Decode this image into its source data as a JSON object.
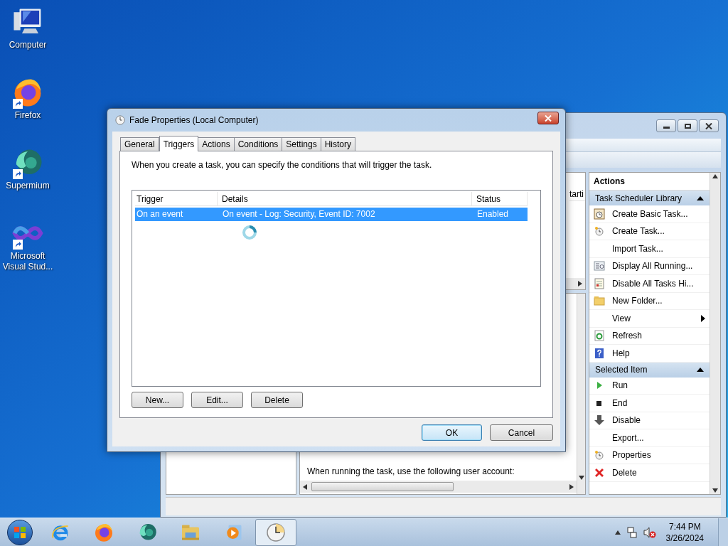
{
  "desktop_icons": [
    {
      "label": "Computer",
      "kind": "computer"
    },
    {
      "label": "Firefox",
      "kind": "firefox"
    },
    {
      "label": "Supermium",
      "kind": "supermium"
    },
    {
      "label": "Microsoft Visual Stud...",
      "kind": "vs"
    }
  ],
  "background_window": {
    "column_header": "tarti",
    "body_text": "When running the task, use the following user account:",
    "actions": {
      "title": "Actions",
      "groups": [
        {
          "title": "Task Scheduler Library",
          "expanded": true,
          "items": [
            {
              "label": "Create Basic Task...",
              "kind": "wizard",
              "submenu": false
            },
            {
              "label": "Create Task...",
              "kind": "clock",
              "submenu": false
            },
            {
              "label": "Import Task...",
              "kind": "none",
              "submenu": false
            },
            {
              "label": "Display All Running...",
              "kind": "list",
              "submenu": false
            },
            {
              "label": "Disable All Tasks Hi...",
              "kind": "notes",
              "submenu": false
            },
            {
              "label": "New Folder...",
              "kind": "folder",
              "submenu": false
            },
            {
              "label": "View",
              "kind": "none",
              "submenu": true
            },
            {
              "label": "Refresh",
              "kind": "refresh",
              "submenu": false
            },
            {
              "label": "Help",
              "kind": "help",
              "submenu": false
            }
          ]
        },
        {
          "title": "Selected Item",
          "expanded": true,
          "items": [
            {
              "label": "Run",
              "kind": "run",
              "submenu": false
            },
            {
              "label": "End",
              "kind": "end",
              "submenu": false
            },
            {
              "label": "Disable",
              "kind": "down",
              "submenu": false
            },
            {
              "label": "Export...",
              "kind": "none",
              "submenu": false
            },
            {
              "label": "Properties",
              "kind": "clock",
              "submenu": false
            },
            {
              "label": "Delete",
              "kind": "delete",
              "submenu": false
            }
          ]
        }
      ]
    }
  },
  "dialog": {
    "title": "Fade Properties (Local Computer)",
    "tabs": [
      {
        "label": "General",
        "selected": false
      },
      {
        "label": "Triggers",
        "selected": true
      },
      {
        "label": "Actions",
        "selected": false
      },
      {
        "label": "Conditions",
        "selected": false
      },
      {
        "label": "Settings",
        "selected": false
      },
      {
        "label": "History",
        "selected": false
      }
    ],
    "description": "When you create a task, you can specify the conditions that will trigger the task.",
    "table": {
      "columns": [
        "Trigger",
        "Details",
        "Status"
      ],
      "rows": [
        {
          "cells": [
            "On an event",
            "On event - Log: Security, Event ID: 7002",
            "Enabled"
          ],
          "selected": true
        }
      ]
    },
    "list_buttons": [
      "New...",
      "Edit...",
      "Delete"
    ],
    "buttons": [
      {
        "label": "OK",
        "default": true
      },
      {
        "label": "Cancel",
        "default": false
      }
    ]
  },
  "taskbar": {
    "apps": [
      {
        "kind": "ie",
        "active": false
      },
      {
        "kind": "firefox",
        "active": false
      },
      {
        "kind": "supermium",
        "active": false
      },
      {
        "kind": "explorer",
        "active": false
      },
      {
        "kind": "media",
        "active": false
      },
      {
        "kind": "clock",
        "active": true
      }
    ],
    "time": "7:44 PM",
    "date": "3/26/2024"
  }
}
